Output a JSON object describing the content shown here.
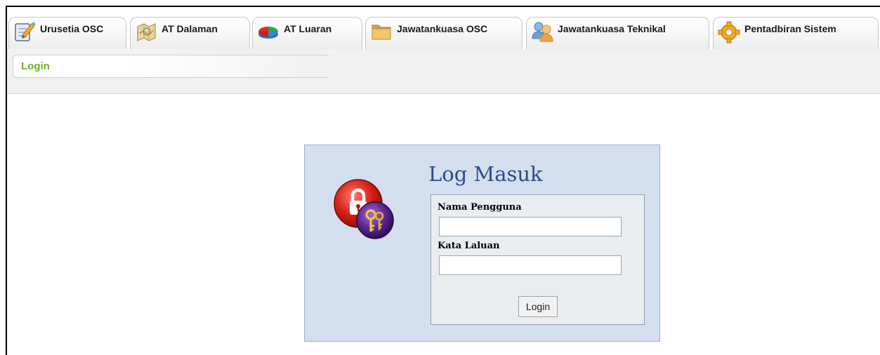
{
  "tabs": [
    {
      "label": "Urusetia OSC",
      "icon": "notepad-pencil-icon"
    },
    {
      "label": "AT Dalaman",
      "icon": "map-icon"
    },
    {
      "label": "AT Luaran",
      "icon": "pie-chart-icon"
    },
    {
      "label": "Jawatankuasa OSC",
      "icon": "folder-icon"
    },
    {
      "label": "Jawatankuasa Teknikal",
      "icon": "users-icon"
    },
    {
      "label": "Pentadbiran Sistem",
      "icon": "gear-icon"
    }
  ],
  "breadcrumb": {
    "current": "Login",
    "color": "#6bb328"
  },
  "login": {
    "title": "Log Masuk",
    "username_label": "Nama Pengguna",
    "username_value": "",
    "password_label": "Kata Laluan",
    "password_value": "",
    "submit_label": "Login",
    "icon": "lock-keys-icon"
  },
  "colors": {
    "panel_bg": "#d3dfee",
    "title_color": "#2d4c86"
  }
}
